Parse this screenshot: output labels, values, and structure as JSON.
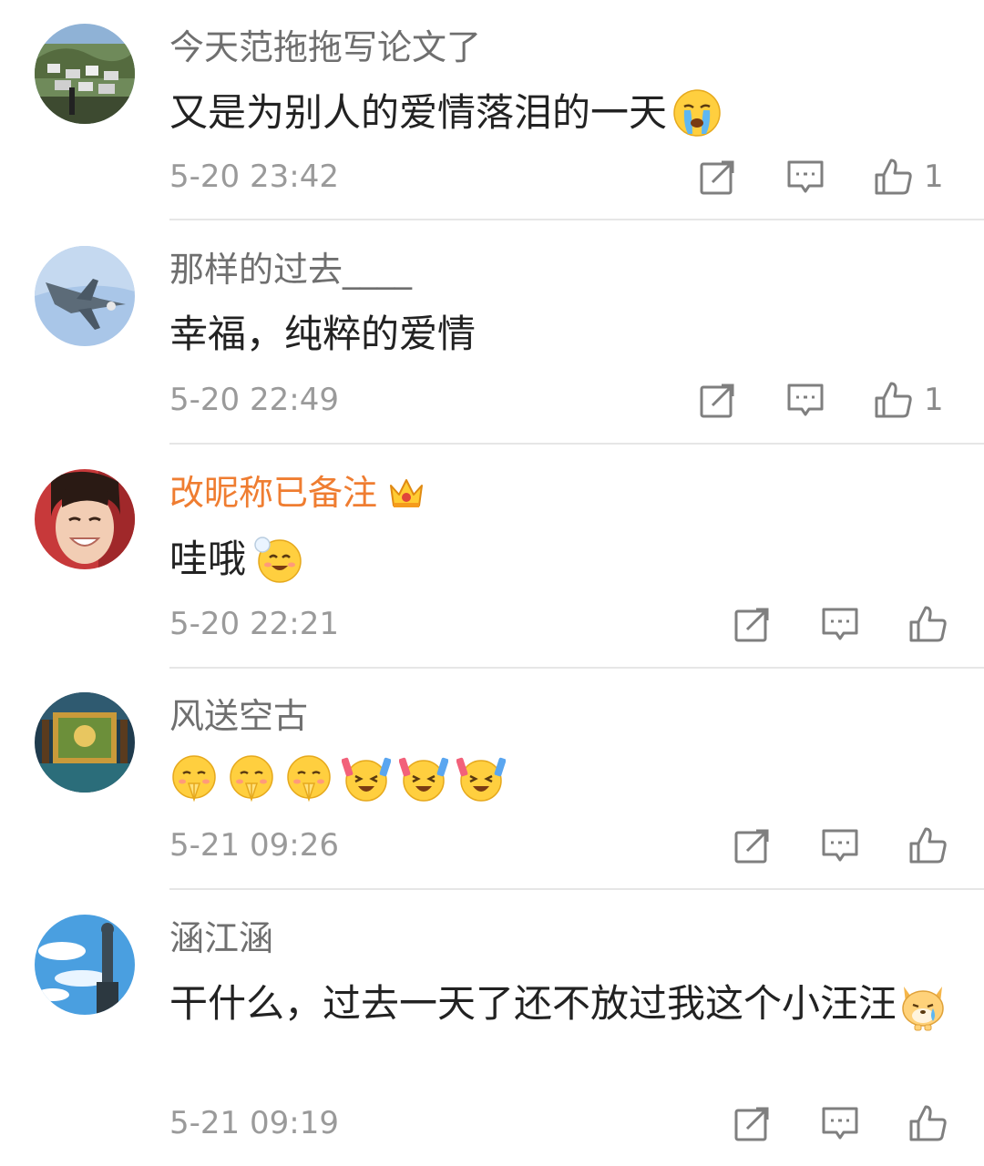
{
  "comments": [
    {
      "author": "今天范拖拖写论文了",
      "text": "又是为别人的爱情落泪的一天",
      "emojis": [
        "crying-face-emoji"
      ],
      "time": "5-20 23:42",
      "likes": "1",
      "avatar": "village-landscape-avatar"
    },
    {
      "author": "那样的过去____",
      "text": "幸福，纯粹的爱情",
      "emojis": [],
      "time": "5-20 22:49",
      "likes": "1",
      "avatar": "fighter-jet-avatar"
    },
    {
      "author": "改昵称已备注",
      "badge": "crown-icon",
      "text": "哇哦",
      "emojis": [
        "blowing-bubble-emoji"
      ],
      "time": "5-20 22:21",
      "likes": "",
      "avatar": "smiling-person-avatar"
    },
    {
      "author": "风送空古",
      "text": "",
      "emojis": [
        "praying-face-emoji",
        "praying-face-emoji",
        "praying-face-emoji",
        "cheering-face-emoji",
        "cheering-face-emoji",
        "cheering-face-emoji"
      ],
      "time": "5-21 09:26",
      "likes": "",
      "avatar": "painted-room-avatar"
    },
    {
      "author": "涵江涵",
      "text": "干什么，过去一天了还不放过我这个小汪汪",
      "emojis": [
        "crying-dog-emoji"
      ],
      "time": "5-21 09:19",
      "likes": "",
      "avatar": "sky-statue-avatar"
    }
  ],
  "icons": {
    "repost": "repost-icon",
    "reply": "comment-icon",
    "like": "thumbs-up-icon"
  },
  "colors": {
    "author": "#6f6f6f",
    "vip_author": "#ef7d31",
    "body_text": "#222222",
    "timestamp": "#9a9a9a",
    "icon": "#7f7f7f",
    "divider": "#e6e6e6"
  }
}
